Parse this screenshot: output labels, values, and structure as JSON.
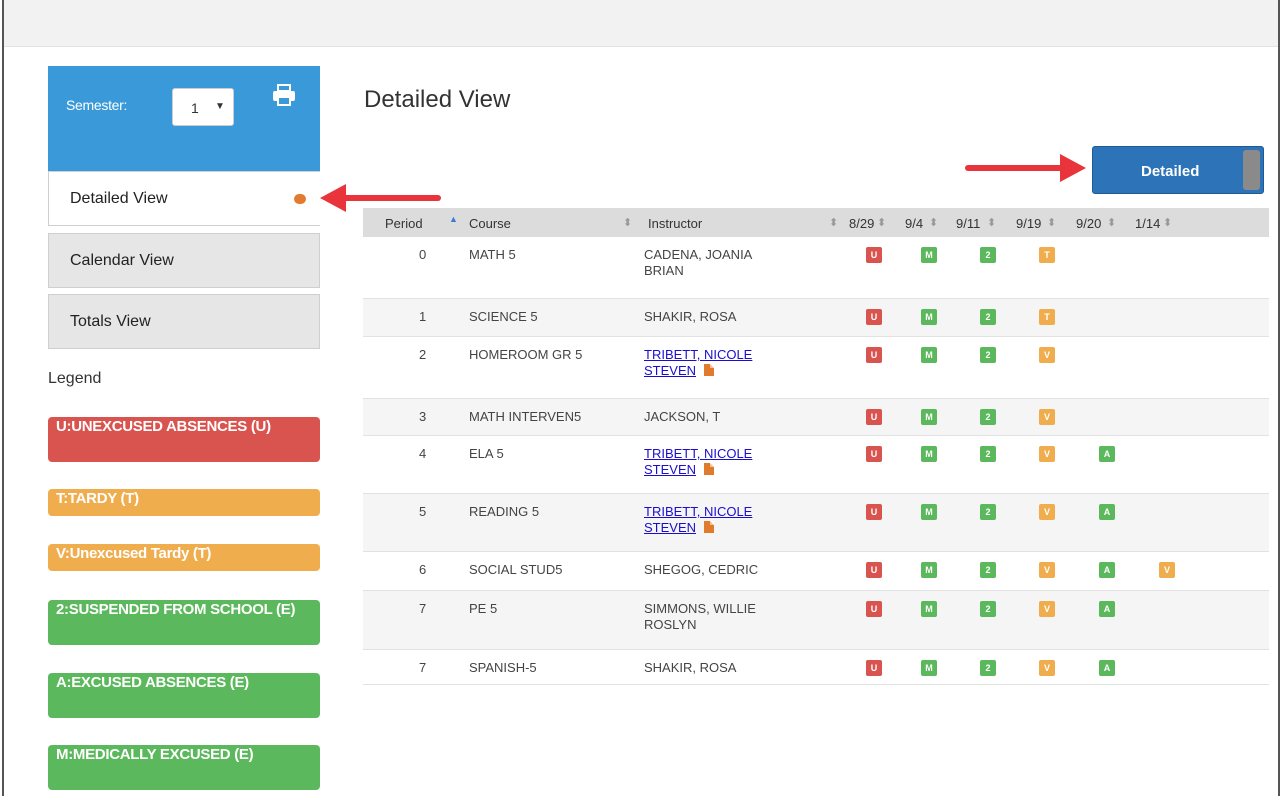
{
  "sidebar": {
    "semester_label": "Semester:",
    "semester_value": "1",
    "nav": [
      "Detailed View",
      "Calendar View",
      "Totals View"
    ],
    "legend_title": "Legend",
    "legend": [
      {
        "label": "U:UNEXCUSED ABSENCES (U)",
        "color": "#d9534f"
      },
      {
        "label": "T:TARDY (T)",
        "color": "#f0ad4e"
      },
      {
        "label": "V:Unexcused Tardy (T)",
        "color": "#f0ad4e"
      },
      {
        "label": "2:SUSPENDED FROM SCHOOL (E)",
        "color": "#5cb85c"
      },
      {
        "label": "A:EXCUSED ABSENCES (E)",
        "color": "#5cb85c"
      },
      {
        "label": "M:MEDICALLY EXCUSED (E)",
        "color": "#5cb85c"
      }
    ]
  },
  "main": {
    "title": "Detailed View",
    "view_toggle_label": "Detailed",
    "columns": [
      "Period",
      "Course",
      "Instructor",
      "8/29",
      "9/4",
      "9/11",
      "9/19",
      "9/20",
      "1/14"
    ],
    "rows": [
      {
        "period": "0",
        "course": "MATH 5",
        "instructor": [
          "CADENA, JOANIA",
          "BRIAN"
        ],
        "link": false,
        "codes": [
          "U",
          "M",
          "2",
          "T",
          "",
          ""
        ]
      },
      {
        "period": "1",
        "course": "SCIENCE 5",
        "instructor": [
          "SHAKIR, ROSA"
        ],
        "link": false,
        "codes": [
          "U",
          "M",
          "2",
          "T",
          "",
          ""
        ]
      },
      {
        "period": "2",
        "course": "HOMEROOM GR 5",
        "instructor": [
          "TRIBETT, NICOLE",
          "STEVEN"
        ],
        "link": true,
        "codes": [
          "U",
          "M",
          "2",
          "V",
          "",
          ""
        ]
      },
      {
        "period": "3",
        "course": "MATH INTERVEN5",
        "instructor": [
          "JACKSON, T"
        ],
        "link": false,
        "codes": [
          "U",
          "M",
          "2",
          "V",
          "",
          ""
        ]
      },
      {
        "period": "4",
        "course": "ELA 5",
        "instructor": [
          "TRIBETT, NICOLE",
          "STEVEN"
        ],
        "link": true,
        "codes": [
          "U",
          "M",
          "2",
          "V",
          "A",
          ""
        ]
      },
      {
        "period": "5",
        "course": "READING 5",
        "instructor": [
          "TRIBETT, NICOLE",
          "STEVEN"
        ],
        "link": true,
        "codes": [
          "U",
          "M",
          "2",
          "V",
          "A",
          ""
        ]
      },
      {
        "period": "6",
        "course": "SOCIAL STUD5",
        "instructor": [
          "SHEGOG, CEDRIC"
        ],
        "link": false,
        "codes": [
          "U",
          "M",
          "2",
          "V",
          "A",
          "V"
        ]
      },
      {
        "period": "7",
        "course": "PE 5",
        "instructor": [
          "SIMMONS, WILLIE",
          "ROSLYN"
        ],
        "link": false,
        "codes": [
          "U",
          "M",
          "2",
          "V",
          "A",
          ""
        ]
      },
      {
        "period": "7",
        "course": "SPANISH-5",
        "instructor": [
          "SHAKIR, ROSA"
        ],
        "link": false,
        "codes": [
          "U",
          "M",
          "2",
          "V",
          "A",
          ""
        ]
      }
    ]
  },
  "colors": {
    "U": "#d9534f",
    "M": "#5cb85c",
    "2": "#5cb85c",
    "A": "#5cb85c",
    "T": "#f0ad4e",
    "V": "#f0ad4e",
    "sidebar_header": "#3a99d8",
    "primary_button": "#2d73b7",
    "annotation_arrow": "#e8343a"
  }
}
